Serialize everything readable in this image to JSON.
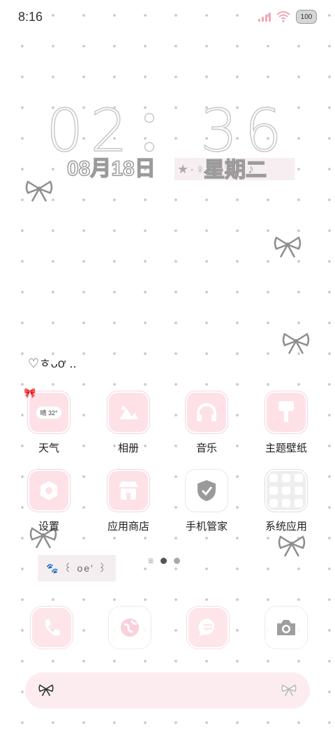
{
  "status_bar": {
    "time": "8:16",
    "battery": "100",
    "signal_icon": "signal-icon",
    "wifi_icon": "wifi-icon"
  },
  "clock_widget": {
    "time": "02：36",
    "date": "08月18日",
    "weekday": "星期二",
    "deco": "★·♀·°·♡··♪"
  },
  "kaomoji": "♡ㅎᴗơ ..",
  "apps": [
    {
      "label": "天气",
      "icon": "weather-icon",
      "chip": "晴 32°"
    },
    {
      "label": "相册",
      "icon": "gallery-icon"
    },
    {
      "label": "音乐",
      "icon": "headphones-icon"
    },
    {
      "label": "主题壁纸",
      "icon": "theme-icon"
    },
    {
      "label": "设置",
      "icon": "settings-icon"
    },
    {
      "label": "应用商店",
      "icon": "store-icon"
    },
    {
      "label": "手机管家",
      "icon": "shield-check-icon"
    },
    {
      "label": "系统应用",
      "icon": "folder-icon"
    }
  ],
  "sticker_text": "🐾 ꒰ oe' ꒱",
  "pager": {
    "pages": 2,
    "current": 1
  },
  "dock": [
    {
      "icon": "phone-icon"
    },
    {
      "icon": "browser-icon"
    },
    {
      "icon": "messages-icon"
    },
    {
      "icon": "camera-icon"
    }
  ],
  "colors": {
    "pink": "#fde1e7",
    "accent_pink": "#f2a7b3",
    "grey_bow": "#8e8e8e"
  }
}
